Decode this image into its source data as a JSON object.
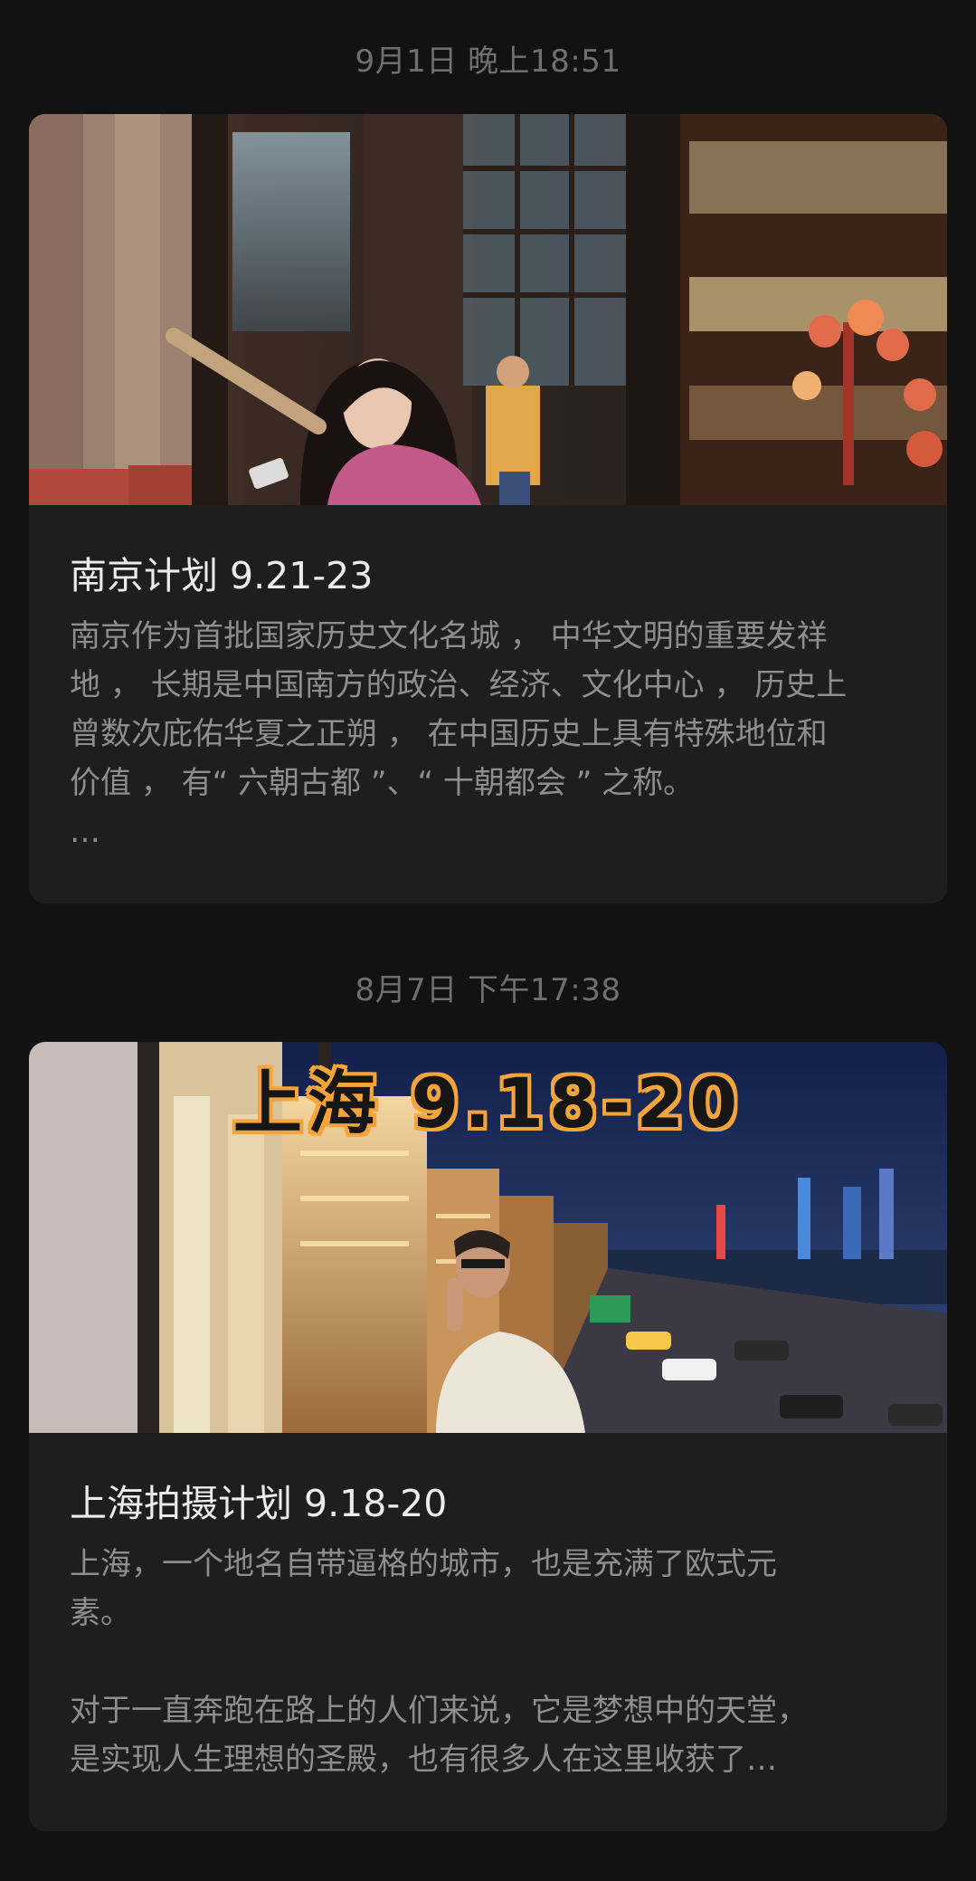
{
  "feed": {
    "items": [
      {
        "timestamp": "9月1日 晚上18:51",
        "title": "南京计划 9.21-23",
        "body": "南京作为首批国家历史文化名城 ， 中华文明的重要发祥\n地 ， 长期是中国南方的政治、经济、文化中心 ， 历史上\n曾数次庇佑华夏之正朔 ， 在中国历史上具有特殊地位和\n价值 ， 有“ 六朝古都 ”、“ 十朝都会 ” 之称。\n…"
      },
      {
        "timestamp": "8月7日 下午17:38",
        "title": "上海拍摄计划 9.18-20",
        "cover_overlay": "上海 9.18-20",
        "body": "上海，一个地名自带逼格的城市，也是充满了欧式元\n素。\n\n对于一直奔跑在路上的人们来说，它是梦想中的天堂，\n是实现人生理想的圣殿，也有很多人在这里收获了…"
      }
    ]
  }
}
